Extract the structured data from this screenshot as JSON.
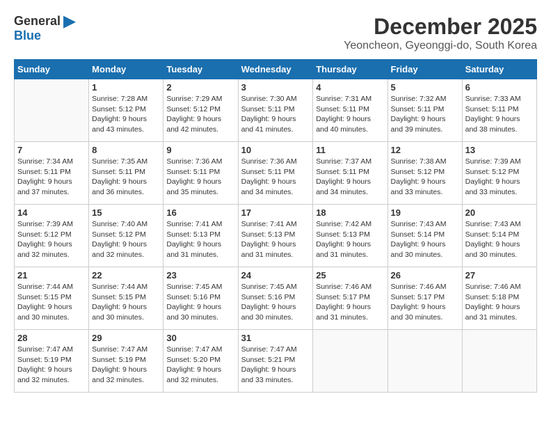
{
  "header": {
    "logo_general": "General",
    "logo_blue": "Blue",
    "month_title": "December 2025",
    "location": "Yeoncheon, Gyeonggi-do, South Korea"
  },
  "days_of_week": [
    "Sunday",
    "Monday",
    "Tuesday",
    "Wednesday",
    "Thursday",
    "Friday",
    "Saturday"
  ],
  "weeks": [
    [
      {
        "day": "",
        "sunrise": "",
        "sunset": "",
        "daylight": ""
      },
      {
        "day": "1",
        "sunrise": "Sunrise: 7:28 AM",
        "sunset": "Sunset: 5:12 PM",
        "daylight": "Daylight: 9 hours and 43 minutes."
      },
      {
        "day": "2",
        "sunrise": "Sunrise: 7:29 AM",
        "sunset": "Sunset: 5:12 PM",
        "daylight": "Daylight: 9 hours and 42 minutes."
      },
      {
        "day": "3",
        "sunrise": "Sunrise: 7:30 AM",
        "sunset": "Sunset: 5:11 PM",
        "daylight": "Daylight: 9 hours and 41 minutes."
      },
      {
        "day": "4",
        "sunrise": "Sunrise: 7:31 AM",
        "sunset": "Sunset: 5:11 PM",
        "daylight": "Daylight: 9 hours and 40 minutes."
      },
      {
        "day": "5",
        "sunrise": "Sunrise: 7:32 AM",
        "sunset": "Sunset: 5:11 PM",
        "daylight": "Daylight: 9 hours and 39 minutes."
      },
      {
        "day": "6",
        "sunrise": "Sunrise: 7:33 AM",
        "sunset": "Sunset: 5:11 PM",
        "daylight": "Daylight: 9 hours and 38 minutes."
      }
    ],
    [
      {
        "day": "7",
        "sunrise": "Sunrise: 7:34 AM",
        "sunset": "Sunset: 5:11 PM",
        "daylight": "Daylight: 9 hours and 37 minutes."
      },
      {
        "day": "8",
        "sunrise": "Sunrise: 7:35 AM",
        "sunset": "Sunset: 5:11 PM",
        "daylight": "Daylight: 9 hours and 36 minutes."
      },
      {
        "day": "9",
        "sunrise": "Sunrise: 7:36 AM",
        "sunset": "Sunset: 5:11 PM",
        "daylight": "Daylight: 9 hours and 35 minutes."
      },
      {
        "day": "10",
        "sunrise": "Sunrise: 7:36 AM",
        "sunset": "Sunset: 5:11 PM",
        "daylight": "Daylight: 9 hours and 34 minutes."
      },
      {
        "day": "11",
        "sunrise": "Sunrise: 7:37 AM",
        "sunset": "Sunset: 5:11 PM",
        "daylight": "Daylight: 9 hours and 34 minutes."
      },
      {
        "day": "12",
        "sunrise": "Sunrise: 7:38 AM",
        "sunset": "Sunset: 5:12 PM",
        "daylight": "Daylight: 9 hours and 33 minutes."
      },
      {
        "day": "13",
        "sunrise": "Sunrise: 7:39 AM",
        "sunset": "Sunset: 5:12 PM",
        "daylight": "Daylight: 9 hours and 33 minutes."
      }
    ],
    [
      {
        "day": "14",
        "sunrise": "Sunrise: 7:39 AM",
        "sunset": "Sunset: 5:12 PM",
        "daylight": "Daylight: 9 hours and 32 minutes."
      },
      {
        "day": "15",
        "sunrise": "Sunrise: 7:40 AM",
        "sunset": "Sunset: 5:12 PM",
        "daylight": "Daylight: 9 hours and 32 minutes."
      },
      {
        "day": "16",
        "sunrise": "Sunrise: 7:41 AM",
        "sunset": "Sunset: 5:13 PM",
        "daylight": "Daylight: 9 hours and 31 minutes."
      },
      {
        "day": "17",
        "sunrise": "Sunrise: 7:41 AM",
        "sunset": "Sunset: 5:13 PM",
        "daylight": "Daylight: 9 hours and 31 minutes."
      },
      {
        "day": "18",
        "sunrise": "Sunrise: 7:42 AM",
        "sunset": "Sunset: 5:13 PM",
        "daylight": "Daylight: 9 hours and 31 minutes."
      },
      {
        "day": "19",
        "sunrise": "Sunrise: 7:43 AM",
        "sunset": "Sunset: 5:14 PM",
        "daylight": "Daylight: 9 hours and 30 minutes."
      },
      {
        "day": "20",
        "sunrise": "Sunrise: 7:43 AM",
        "sunset": "Sunset: 5:14 PM",
        "daylight": "Daylight: 9 hours and 30 minutes."
      }
    ],
    [
      {
        "day": "21",
        "sunrise": "Sunrise: 7:44 AM",
        "sunset": "Sunset: 5:15 PM",
        "daylight": "Daylight: 9 hours and 30 minutes."
      },
      {
        "day": "22",
        "sunrise": "Sunrise: 7:44 AM",
        "sunset": "Sunset: 5:15 PM",
        "daylight": "Daylight: 9 hours and 30 minutes."
      },
      {
        "day": "23",
        "sunrise": "Sunrise: 7:45 AM",
        "sunset": "Sunset: 5:16 PM",
        "daylight": "Daylight: 9 hours and 30 minutes."
      },
      {
        "day": "24",
        "sunrise": "Sunrise: 7:45 AM",
        "sunset": "Sunset: 5:16 PM",
        "daylight": "Daylight: 9 hours and 30 minutes."
      },
      {
        "day": "25",
        "sunrise": "Sunrise: 7:46 AM",
        "sunset": "Sunset: 5:17 PM",
        "daylight": "Daylight: 9 hours and 31 minutes."
      },
      {
        "day": "26",
        "sunrise": "Sunrise: 7:46 AM",
        "sunset": "Sunset: 5:17 PM",
        "daylight": "Daylight: 9 hours and 30 minutes."
      },
      {
        "day": "27",
        "sunrise": "Sunrise: 7:46 AM",
        "sunset": "Sunset: 5:18 PM",
        "daylight": "Daylight: 9 hours and 31 minutes."
      }
    ],
    [
      {
        "day": "28",
        "sunrise": "Sunrise: 7:47 AM",
        "sunset": "Sunset: 5:19 PM",
        "daylight": "Daylight: 9 hours and 32 minutes."
      },
      {
        "day": "29",
        "sunrise": "Sunrise: 7:47 AM",
        "sunset": "Sunset: 5:19 PM",
        "daylight": "Daylight: 9 hours and 32 minutes."
      },
      {
        "day": "30",
        "sunrise": "Sunrise: 7:47 AM",
        "sunset": "Sunset: 5:20 PM",
        "daylight": "Daylight: 9 hours and 32 minutes."
      },
      {
        "day": "31",
        "sunrise": "Sunrise: 7:47 AM",
        "sunset": "Sunset: 5:21 PM",
        "daylight": "Daylight: 9 hours and 33 minutes."
      },
      {
        "day": "",
        "sunrise": "",
        "sunset": "",
        "daylight": ""
      },
      {
        "day": "",
        "sunrise": "",
        "sunset": "",
        "daylight": ""
      },
      {
        "day": "",
        "sunrise": "",
        "sunset": "",
        "daylight": ""
      }
    ]
  ]
}
